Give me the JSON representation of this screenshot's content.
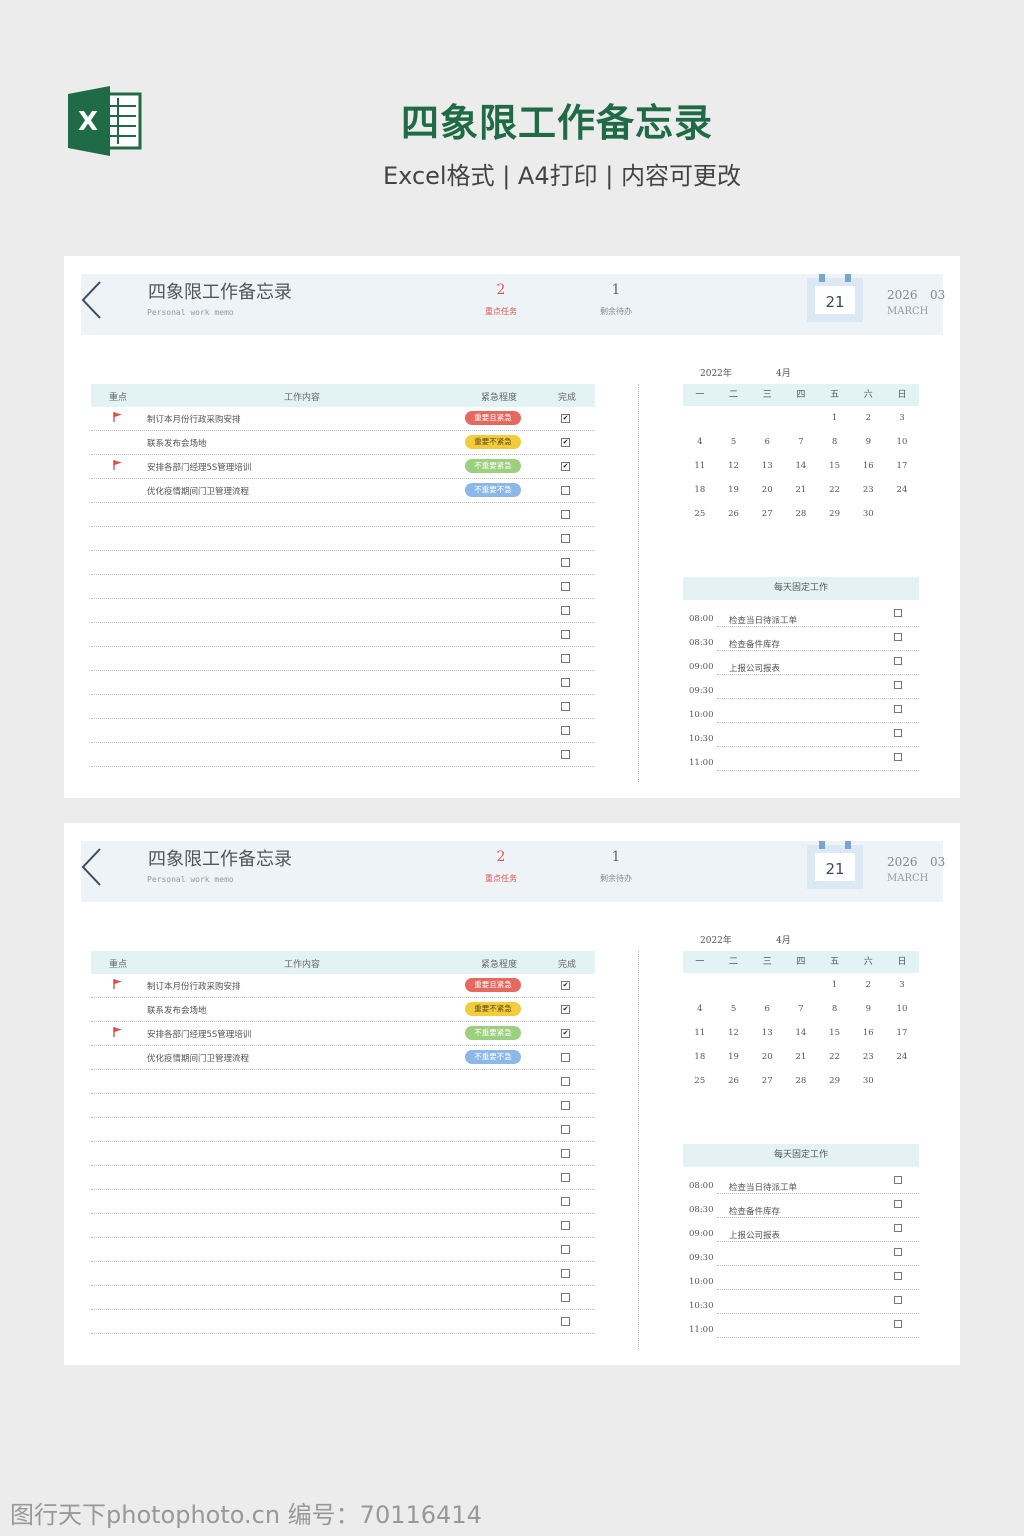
{
  "header": {
    "title": "四象限工作备忘录",
    "subtitle": "Excel格式 | A4打印 | 内容可更改",
    "logo_letter": "X"
  },
  "memo": {
    "title": "四象限工作备忘录",
    "subtitle": "Personal work memo",
    "key_count": "2",
    "key_label": "重点任务",
    "pending_count": "1",
    "pending_label": "剩余待办",
    "day": "21",
    "year": "2026",
    "month_num": "03",
    "month_name": "MARCH"
  },
  "tasks": {
    "headers": [
      "重点",
      "工作内容",
      "紧急程度",
      "完成"
    ],
    "rows": [
      {
        "flag": true,
        "text": "制订本月份行政采购安排",
        "level": "重要且紧急",
        "color": "#e46a5f",
        "done": true
      },
      {
        "flag": false,
        "text": "联系发布会场地",
        "level": "重要不紧急",
        "color": "#f2cc3d",
        "done": true
      },
      {
        "flag": true,
        "text": "安排各部门经理5S管理培训",
        "level": "不重要紧急",
        "color": "#9ccf7e",
        "done": true
      },
      {
        "flag": false,
        "text": "优化疫情期间门卫管理流程",
        "level": "不重要不急",
        "color": "#8bb8e8",
        "done": false
      }
    ],
    "empty_rows": 11
  },
  "calendar": {
    "year_label": "2022年",
    "month_label": "4月",
    "weekdays": [
      "一",
      "二",
      "三",
      "四",
      "五",
      "六",
      "日"
    ],
    "weeks": [
      [
        "",
        "",
        "",
        "",
        "1",
        "2",
        "3"
      ],
      [
        "4",
        "5",
        "6",
        "7",
        "8",
        "9",
        "10"
      ],
      [
        "11",
        "12",
        "13",
        "14",
        "15",
        "16",
        "17"
      ],
      [
        "18",
        "19",
        "20",
        "21",
        "22",
        "23",
        "24"
      ],
      [
        "25",
        "26",
        "27",
        "28",
        "29",
        "30",
        ""
      ]
    ]
  },
  "daily": {
    "title": "每天固定工作",
    "rows": [
      {
        "time": "08:00",
        "work": "检查当日待派工单"
      },
      {
        "time": "08:30",
        "work": "检查备件库存"
      },
      {
        "time": "09:00",
        "work": "上报公司报表"
      },
      {
        "time": "09:30",
        "work": ""
      },
      {
        "time": "10:00",
        "work": ""
      },
      {
        "time": "10:30",
        "work": ""
      },
      {
        "time": "11:00",
        "work": ""
      }
    ]
  },
  "watermark": "图行天下photophoto.cn 编号：70116414",
  "colors": {
    "brand_green": "#1f6b45",
    "accent_red": "#e0554d",
    "header_bg": "#e3f3f3"
  }
}
